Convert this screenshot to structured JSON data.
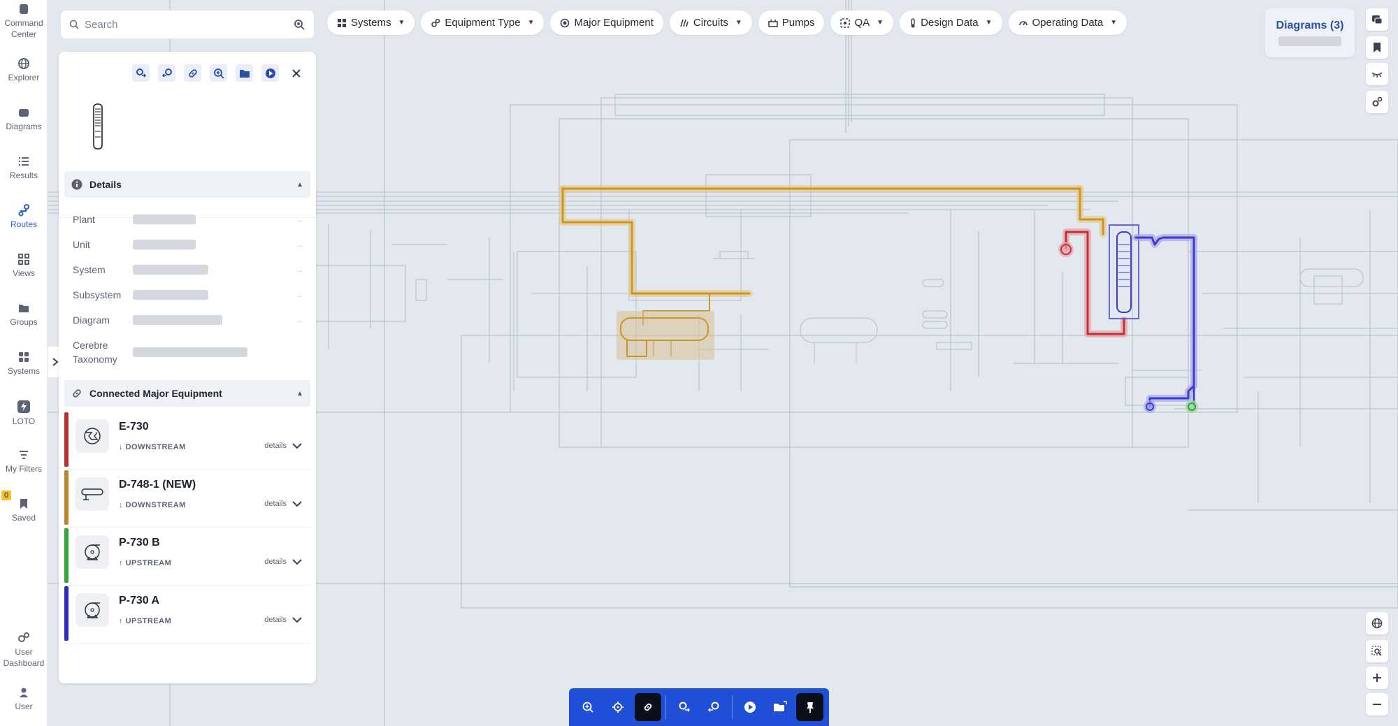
{
  "nav": [
    {
      "label_lines": [
        "Command",
        "Center"
      ],
      "icon": "command-center-icon"
    },
    {
      "label_lines": [
        "Explorer"
      ],
      "icon": "globe-icon"
    },
    {
      "label_lines": [
        "Diagrams"
      ],
      "icon": "diagrams-icon"
    },
    {
      "label_lines": [
        "Results"
      ],
      "icon": "list-icon"
    },
    {
      "label_lines": [
        "Routes"
      ],
      "icon": "routes-icon",
      "active": true
    },
    {
      "label_lines": [
        "Views"
      ],
      "icon": "views-icon"
    },
    {
      "label_lines": [
        "Groups"
      ],
      "icon": "folder-icon"
    },
    {
      "label_lines": [
        "Systems"
      ],
      "icon": "systems-icon"
    },
    {
      "label_lines": [
        "LOTO"
      ],
      "icon": "loto-icon"
    },
    {
      "label_lines": [
        "My Filters"
      ],
      "icon": "filter-icon"
    },
    {
      "label_lines": [
        "Saved"
      ],
      "icon": "bookmark-icon"
    },
    {
      "label_lines": [
        "User",
        "Dashboard"
      ],
      "icon": "user-dashboard-icon"
    },
    {
      "label_lines": [
        "User"
      ],
      "icon": "user-icon"
    }
  ],
  "saved_badge": "0",
  "search": {
    "placeholder": "Search"
  },
  "filters": [
    {
      "label": "Systems",
      "icon": "grid-icon",
      "dropdown": true
    },
    {
      "label": "Equipment Type",
      "icon": "equipment-type-icon",
      "dropdown": true
    },
    {
      "label": "Major Equipment",
      "icon": "major-equipment-icon",
      "dropdown": false
    },
    {
      "label": "Circuits",
      "icon": "circuits-icon",
      "dropdown": true
    },
    {
      "label": "Pumps",
      "icon": "pumps-icon",
      "dropdown": false
    },
    {
      "label": "QA",
      "icon": "qa-icon",
      "dropdown": true
    },
    {
      "label": "Design Data",
      "icon": "thermometer-icon",
      "dropdown": true
    },
    {
      "label": "Operating Data",
      "icon": "gauge-icon",
      "dropdown": true
    }
  ],
  "diagrams_card": {
    "label": "Diagrams (3)"
  },
  "panel": {
    "details_title": "Details",
    "details": [
      {
        "label": "Plant"
      },
      {
        "label": "Unit"
      },
      {
        "label": "System"
      },
      {
        "label": "Subsystem"
      },
      {
        "label": "Diagram"
      },
      {
        "label": "Cerebre Taxonomy"
      }
    ],
    "connected_title": "Connected Major Equipment",
    "equipment": [
      {
        "name": "E-730",
        "direction": "DOWNSTREAM",
        "arrow": "↓",
        "color": "#b83232",
        "icon": "heat-exchanger-icon"
      },
      {
        "name": "D-748-1 (NEW)",
        "direction": "DOWNSTREAM",
        "arrow": "↓",
        "color": "#b8862c",
        "icon": "drum-icon"
      },
      {
        "name": "P-730 B",
        "direction": "UPSTREAM",
        "arrow": "↑",
        "color": "#2fa83a",
        "icon": "pump-icon"
      },
      {
        "name": "P-730 A",
        "direction": "UPSTREAM",
        "arrow": "↑",
        "color": "#2e2fb8",
        "icon": "pump-icon"
      }
    ],
    "details_link": "details"
  },
  "colors": {
    "accent": "#1f4fd6",
    "route_orange": "#c8962a",
    "route_red": "#c0303a",
    "route_blue": "#3c3cd0",
    "route_green": "#2fa83a"
  }
}
